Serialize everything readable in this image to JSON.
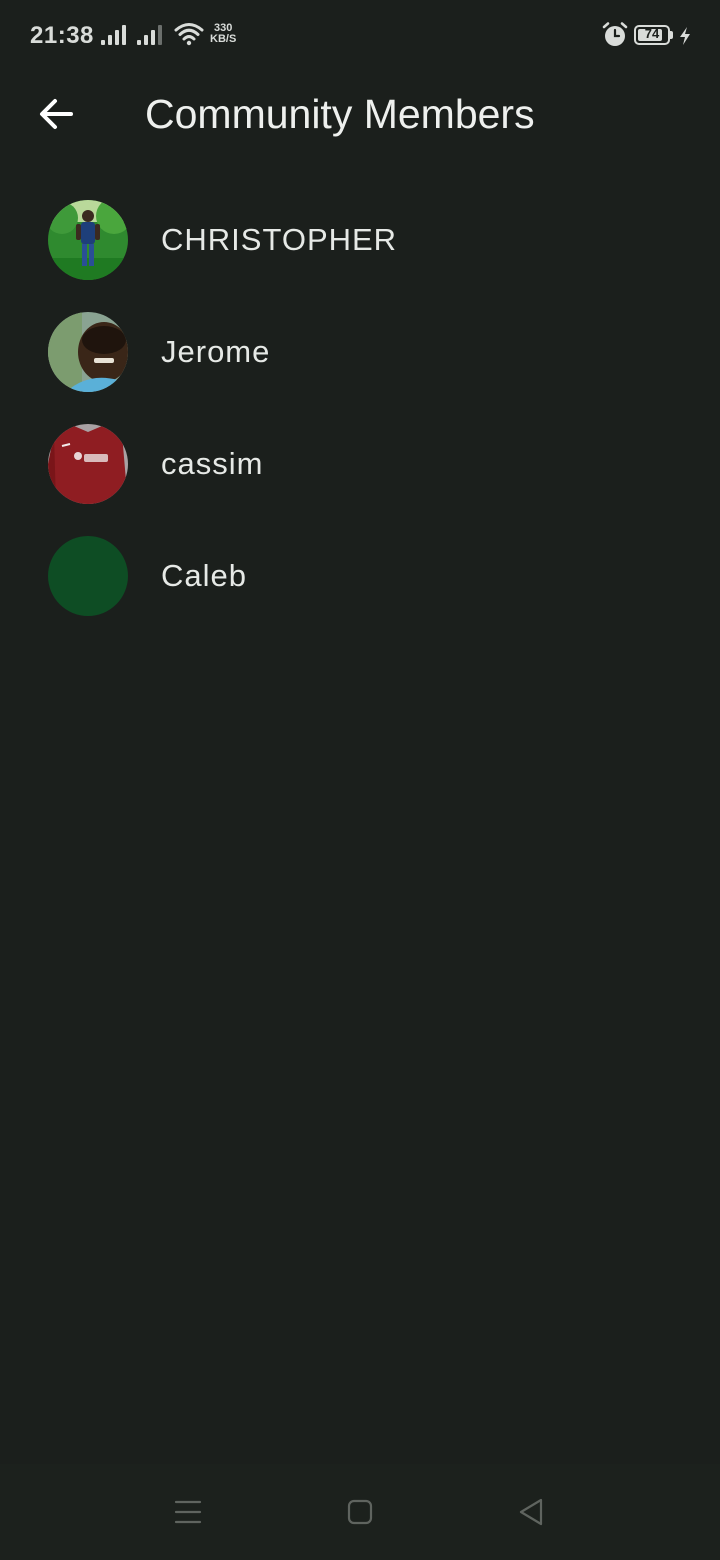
{
  "status_bar": {
    "time": "21:38",
    "net_speed_value": "330",
    "net_speed_unit": "KB/S",
    "battery_level": "74",
    "icons": [
      "signal-icon",
      "signal-icon",
      "wifi-icon",
      "alarm-icon",
      "battery-icon",
      "charging-icon"
    ]
  },
  "header": {
    "title": "Community Members",
    "back_icon": "arrow-left-icon"
  },
  "members": [
    {
      "name": "CHRISTOPHER",
      "avatar": "photo"
    },
    {
      "name": "Jerome",
      "avatar": "photo"
    },
    {
      "name": "cassim",
      "avatar": "photo"
    },
    {
      "name": "Caleb",
      "avatar": "placeholder",
      "avatar_color": "#0e4d24"
    }
  ],
  "nav_bar": {
    "icons": [
      "menu-icon",
      "home-square-icon",
      "back-triangle-icon"
    ]
  },
  "colors": {
    "background": "#1b1f1c",
    "text": "#e9ece9",
    "caleb_avatar": "#0e4d24"
  }
}
